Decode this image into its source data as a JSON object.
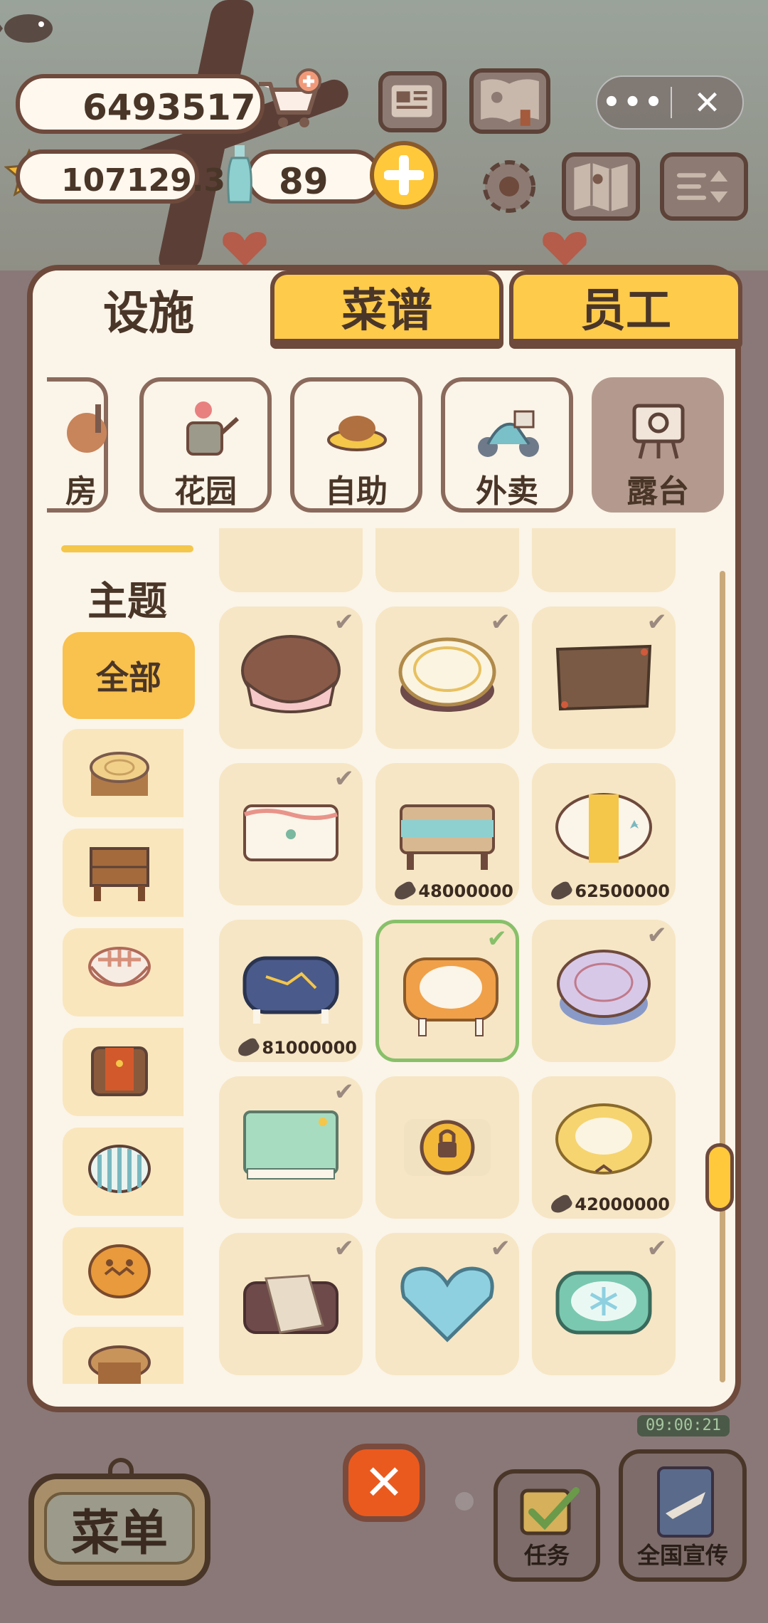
{
  "hud": {
    "coins": "6493517",
    "stars": "107129.3",
    "bottles": "89",
    "menu_dots": "•••",
    "close_symbol": "✕"
  },
  "tabs": [
    {
      "label": "设施",
      "active": true
    },
    {
      "label": "菜谱",
      "active": false
    },
    {
      "label": "员工",
      "active": false
    }
  ],
  "categories": [
    {
      "label": "房",
      "icon": "kitchen-icon"
    },
    {
      "label": "花园",
      "icon": "watering-can-icon"
    },
    {
      "label": "自助",
      "icon": "buffet-icon"
    },
    {
      "label": "外卖",
      "icon": "scooter-icon"
    },
    {
      "label": "露台",
      "icon": "terrace-icon",
      "active": true
    }
  ],
  "theme": {
    "title": "主题",
    "all_label": "全部",
    "items": [
      "log-table",
      "wood-table",
      "checkered-table",
      "red-cloth-table",
      "striped-table",
      "pumpkin-table",
      "round-wood-table"
    ]
  },
  "items": [
    {
      "name": "choco-table",
      "owned": true,
      "price": ""
    },
    {
      "name": "cream-round-table",
      "owned": true,
      "price": ""
    },
    {
      "name": "rustic-plank-table",
      "owned": true,
      "price": ""
    },
    {
      "name": "ribbon-table",
      "owned": true,
      "price": ""
    },
    {
      "name": "teal-stripe-table",
      "owned": false,
      "price": "48000000"
    },
    {
      "name": "yellow-runner-table",
      "owned": false,
      "price": "62500000"
    },
    {
      "name": "navy-gold-table",
      "owned": false,
      "price": "81000000"
    },
    {
      "name": "orange-lace-table",
      "owned": true,
      "selected": true,
      "price": ""
    },
    {
      "name": "lavender-table",
      "owned": true,
      "price": ""
    },
    {
      "name": "mint-table",
      "owned": true,
      "price": ""
    },
    {
      "name": "locked-table",
      "owned": false,
      "locked": true,
      "price": ""
    },
    {
      "name": "yellow-bow-table",
      "owned": false,
      "price": "42000000"
    },
    {
      "name": "draped-table",
      "owned": true,
      "price": ""
    },
    {
      "name": "heart-table",
      "owned": true,
      "price": ""
    },
    {
      "name": "snowflake-table",
      "owned": true,
      "price": ""
    }
  ],
  "bottom": {
    "menu_label": "菜单",
    "close_symbol": "✕",
    "task_label": "任务",
    "promo_label": "全国宣传",
    "timer": "09:00:21"
  },
  "colors": {
    "accent_yellow": "#ffc93b",
    "panel_bg": "#fbf4e8",
    "border_brown": "#6e4a3c",
    "selected_green": "#88c06a",
    "close_orange": "#ea5a1e"
  }
}
